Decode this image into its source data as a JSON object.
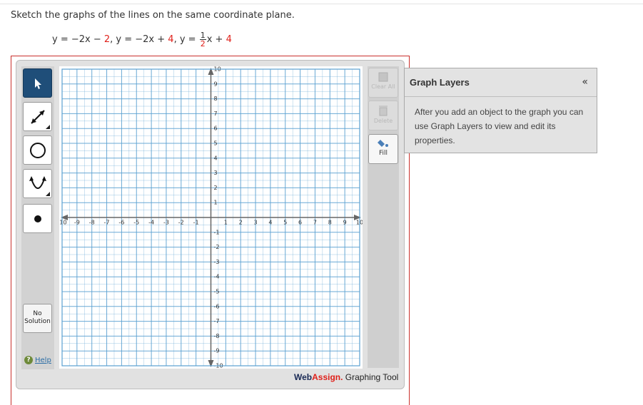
{
  "question": {
    "prompt": "Sketch the graphs of the lines on the same coordinate plane.",
    "eq1_prefix": "y = −2x − ",
    "eq1_const": "2",
    "eq_sep1": ",  y = −2x + ",
    "eq2_const": "4",
    "eq_sep2": ",  y = ",
    "eq3_num": "1",
    "eq3_den": "2",
    "eq3_tail": "x + ",
    "eq3_const": "4"
  },
  "toolbar": {
    "no_solution_line1": "No",
    "no_solution_line2": "Solution",
    "help_label": "Help"
  },
  "right_tools": {
    "clear_all_label": "Clear All",
    "delete_label": "Delete",
    "fill_label": "Fill"
  },
  "graph": {
    "x_min": -10,
    "x_max": 10,
    "y_min": -10,
    "y_max": 10,
    "minor_step": 0.5,
    "x_tick_labels": [
      "-10",
      "-9",
      "-8",
      "-7",
      "-6",
      "-5",
      "-4",
      "-3",
      "-2",
      "-1",
      "1",
      "2",
      "3",
      "4",
      "5",
      "6",
      "7",
      "8",
      "9",
      "10"
    ],
    "y_tick_labels": [
      "10",
      "9",
      "8",
      "7",
      "6",
      "5",
      "4",
      "3",
      "2",
      "1",
      "-1",
      "-2",
      "-3",
      "-4",
      "-5",
      "-6",
      "-7",
      "-8",
      "-9",
      "-10"
    ],
    "grid_color": "#5aa0d0",
    "axis_color": "#666666"
  },
  "brand": {
    "web": "Web",
    "assign": "Assign.",
    "tool": " Graphing Tool"
  },
  "graph_layers": {
    "title": "Graph Layers",
    "collapse_icon": "«",
    "description": "After you add an object to the graph you can use Graph Layers to view and edit its properties."
  },
  "colors": {
    "accent_red": "#e0201a",
    "tool_active": "#1f4e79"
  }
}
